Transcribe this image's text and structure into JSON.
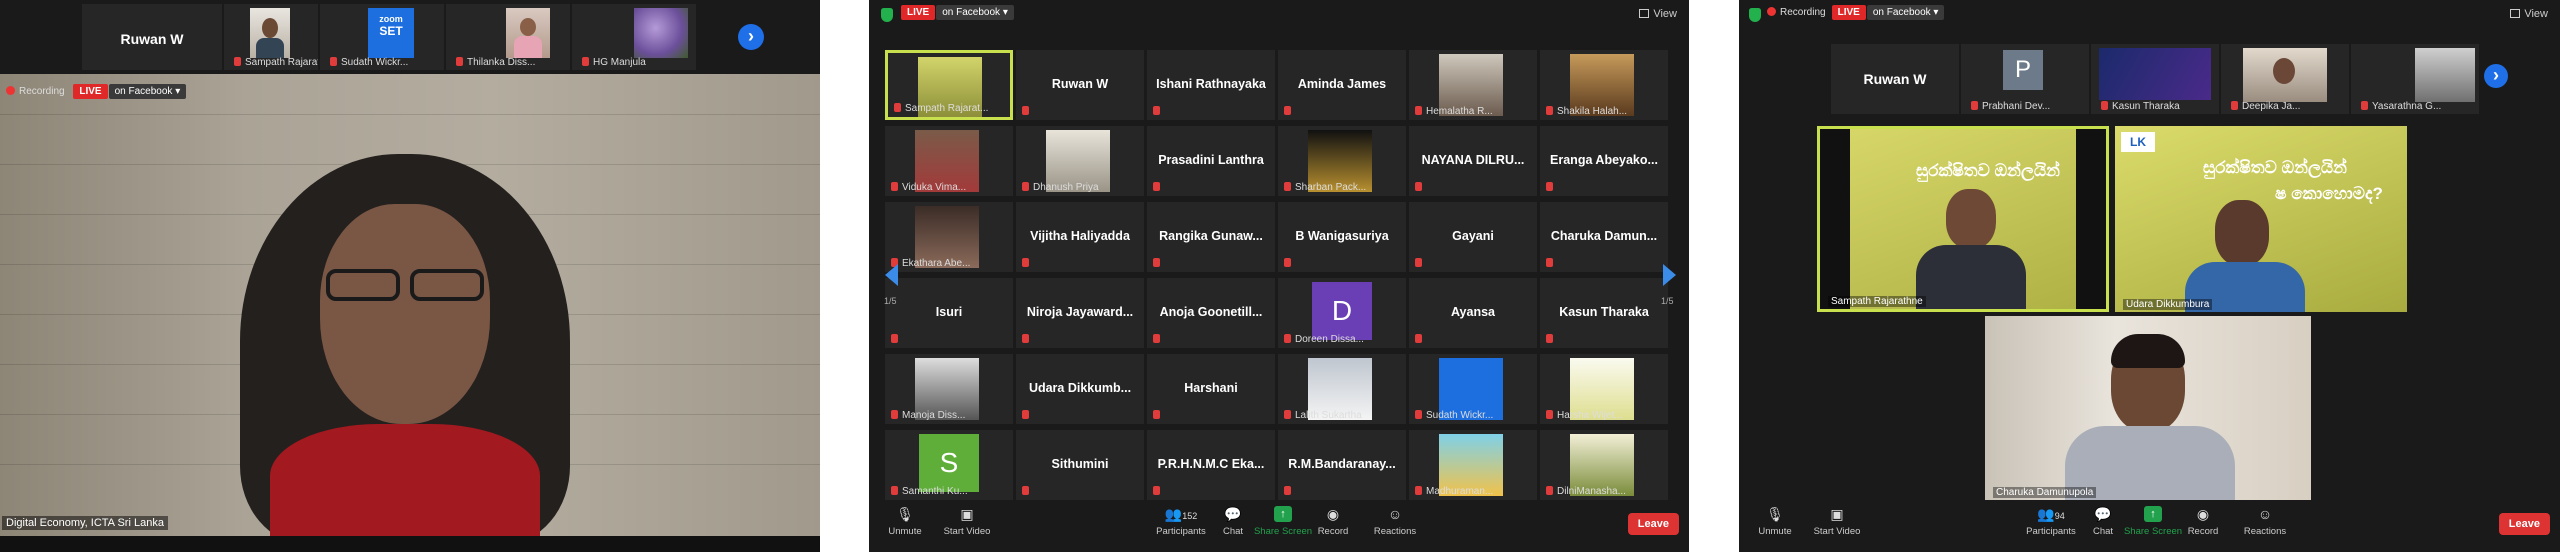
{
  "panel1": {
    "strip": [
      {
        "name": "Ruwan W",
        "caption": ""
      },
      {
        "name": "",
        "caption": "Sampath Rajarat..."
      },
      {
        "name": "",
        "caption": "Sudath Wickr..."
      },
      {
        "name": "",
        "caption": "Thilanka Diss..."
      },
      {
        "name": "",
        "caption": "HG Manjula"
      }
    ],
    "next_icon": "›",
    "recording_label": "Recording",
    "live_label": "LIVE",
    "facebook_label": "on Facebook ▾",
    "speaker_caption": "Digital Economy, ICTA Sri Lanka"
  },
  "panel2": {
    "live_label": "LIVE",
    "facebook_label": "on Facebook ▾",
    "view_label": "View",
    "page_left": "1/5",
    "page_right": "1/5",
    "tiles": [
      {
        "name": "",
        "caption": "Sampath Rajarat..."
      },
      {
        "name": "Ruwan W",
        "caption": ""
      },
      {
        "name": "Ishani Rathnayaka",
        "caption": ""
      },
      {
        "name": "Aminda James",
        "caption": ""
      },
      {
        "name": "",
        "caption": "Hemalatha R..."
      },
      {
        "name": "",
        "caption": "Shakila Halah..."
      },
      {
        "name": "",
        "caption": "Viduka Vima..."
      },
      {
        "name": "",
        "caption": "Dhanush Priya"
      },
      {
        "name": "Prasadini Lanthra",
        "caption": ""
      },
      {
        "name": "",
        "caption": "Sharban Pack..."
      },
      {
        "name": "NAYANA DILRU...",
        "caption": ""
      },
      {
        "name": "Eranga Abeyako...",
        "caption": ""
      },
      {
        "name": "",
        "caption": "Ekathara Abe..."
      },
      {
        "name": "Vijitha Haliyadda",
        "caption": ""
      },
      {
        "name": "Rangika Gunaw...",
        "caption": ""
      },
      {
        "name": "B Wanigasuriya",
        "caption": ""
      },
      {
        "name": "Gayani",
        "caption": ""
      },
      {
        "name": "Charuka Damun...",
        "caption": ""
      },
      {
        "name": "Isuri",
        "caption": ""
      },
      {
        "name": "Niroja Jayaward...",
        "caption": ""
      },
      {
        "name": "Anoja Goonetill...",
        "caption": ""
      },
      {
        "name": "",
        "caption": "Doreen Dissa..."
      },
      {
        "name": "Ayansa",
        "caption": ""
      },
      {
        "name": "Kasun Tharaka",
        "caption": ""
      },
      {
        "name": "",
        "caption": "Manoja Diss..."
      },
      {
        "name": "Udara Dikkumb...",
        "caption": ""
      },
      {
        "name": "Harshani",
        "caption": ""
      },
      {
        "name": "",
        "caption": "Lalith Sukartha"
      },
      {
        "name": "",
        "caption": "Sudath Wickr..."
      },
      {
        "name": "",
        "caption": "Harsha Wijet..."
      },
      {
        "name": "",
        "caption": "Samanthi Ku..."
      },
      {
        "name": "Sithumini",
        "caption": ""
      },
      {
        "name": "P.R.H.N.M.C Eka...",
        "caption": ""
      },
      {
        "name": "R.M.Bandaranay...",
        "caption": ""
      },
      {
        "name": "",
        "caption": "Madhuraman..."
      },
      {
        "name": "",
        "caption": "DilniManasha..."
      }
    ],
    "avatar_D": "D",
    "avatar_S": "S",
    "controls": {
      "unmute": "Unmute",
      "start_video": "Start Video",
      "participants": "Participants",
      "participants_count": "152",
      "chat": "Chat",
      "share": "Share Screen",
      "record": "Record",
      "reactions": "Reactions",
      "leave": "Leave"
    }
  },
  "panel3": {
    "recording_label": "Recording",
    "live_label": "LIVE",
    "facebook_label": "on Facebook ▾",
    "view_label": "View",
    "strip": [
      {
        "name": "Ruwan W",
        "caption": ""
      },
      {
        "name": "",
        "caption": "Prabhani Dev..."
      },
      {
        "name": "",
        "caption": "Kasun Tharaka"
      },
      {
        "name": "",
        "caption": "Deepika Ja..."
      },
      {
        "name": "",
        "caption": "Yasarathna G..."
      }
    ],
    "avatar_P": "P",
    "speakers": [
      {
        "caption": "Sampath Rajarathne"
      },
      {
        "caption": "Udara Dikkumbura"
      },
      {
        "caption": "Charuka Damunupola"
      }
    ],
    "banner_text_1": "සුරක්ෂිතව ඔන්ලයින්",
    "banner_text_2": "ෂ කොහොමද?",
    "controls": {
      "unmute": "Unmute",
      "start_video": "Start Video",
      "participants": "Participants",
      "participants_count": "94",
      "chat": "Chat",
      "share": "Share Screen",
      "record": "Record",
      "reactions": "Reactions",
      "leave": "Leave"
    }
  }
}
